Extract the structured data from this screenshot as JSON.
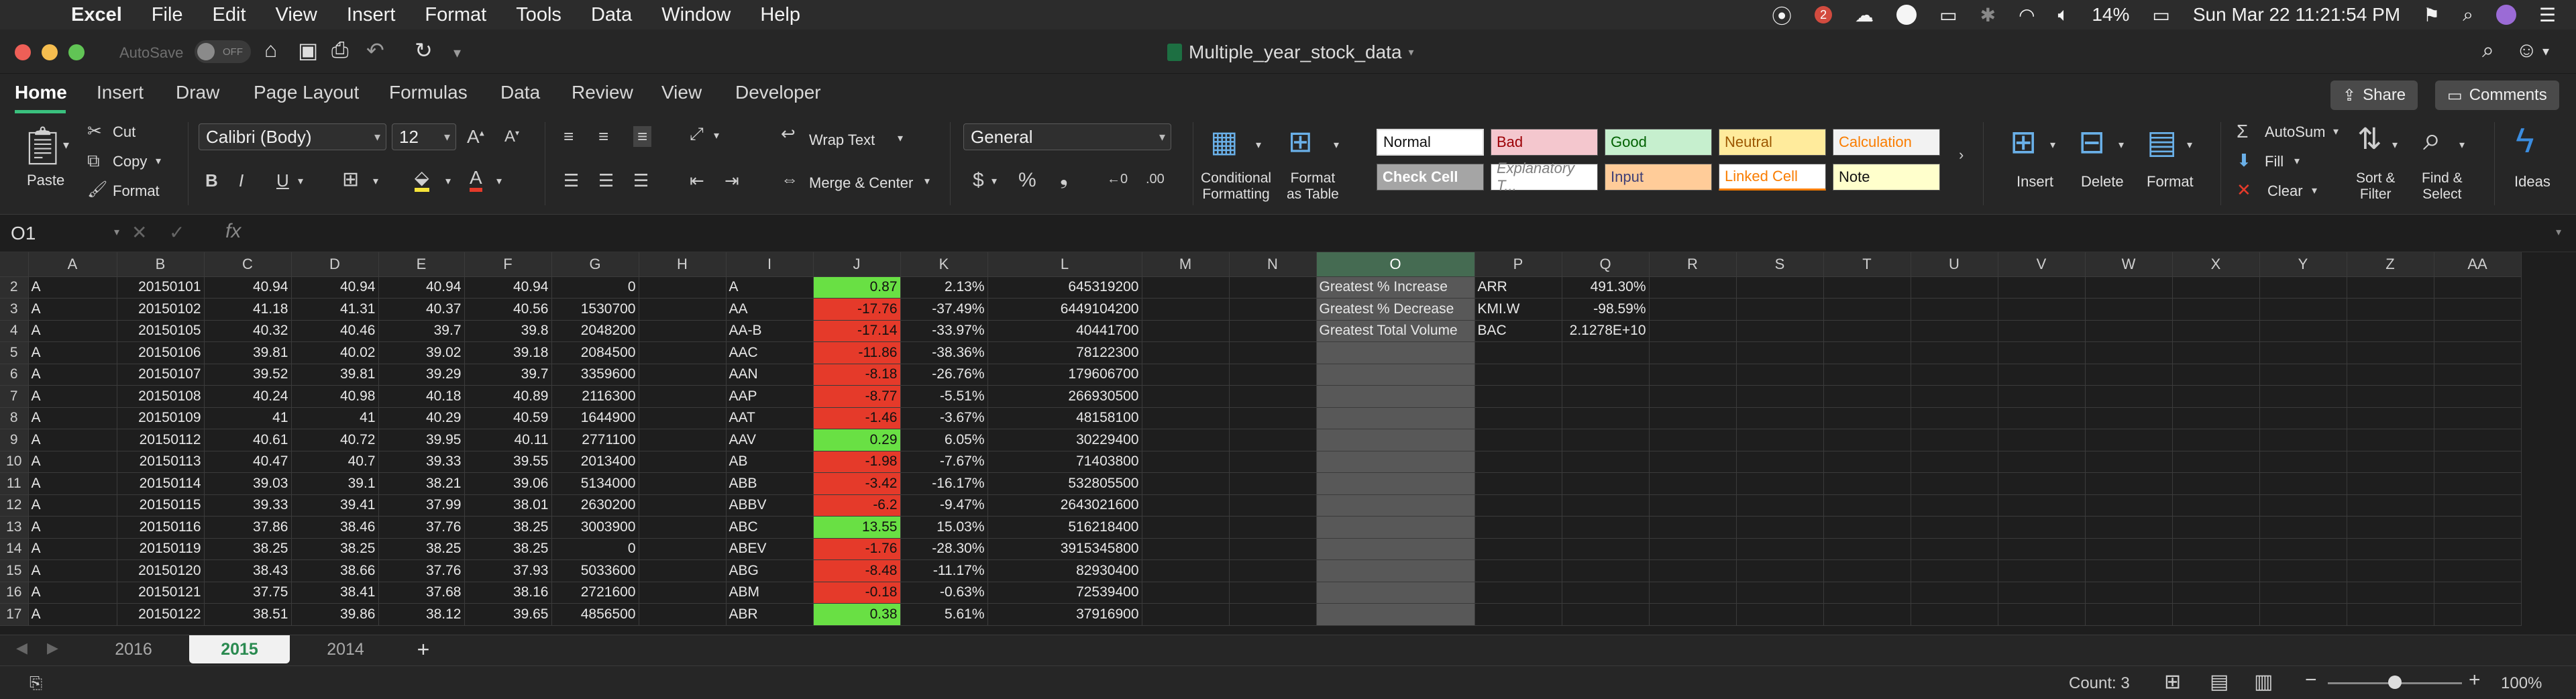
{
  "menubar": {
    "app": "Excel",
    "items": [
      "File",
      "Edit",
      "View",
      "Insert",
      "Format",
      "Tools",
      "Data",
      "Window",
      "Help"
    ],
    "badge": "2",
    "battery": "14%",
    "datetime": "Sun Mar 22  11:21:54 PM"
  },
  "titlebar": {
    "autosave": "AutoSave",
    "toggle": "OFF",
    "document": "Multiple_year_stock_data"
  },
  "ribbon_tabs": [
    "Home",
    "Insert",
    "Draw",
    "Page Layout",
    "Formulas",
    "Data",
    "Review",
    "View",
    "Developer"
  ],
  "share": "Share",
  "comments": "Comments",
  "ribbon": {
    "paste": "Paste",
    "cut": "Cut",
    "copy": "Copy",
    "format": "Format",
    "font": "Calibri (Body)",
    "size": "12",
    "wrap": "Wrap Text",
    "merge": "Merge & Center",
    "number_format": "General",
    "cond": "Conditional\nFormatting",
    "fmt_table": "Format\nas Table",
    "styles": [
      {
        "label": "Normal",
        "bg": "#ffffff",
        "fg": "#111111"
      },
      {
        "label": "Bad",
        "bg": "#f4c7ce",
        "fg": "#9c0006"
      },
      {
        "label": "Good",
        "bg": "#c6efce",
        "fg": "#006100"
      },
      {
        "label": "Neutral",
        "bg": "#ffeb9c",
        "fg": "#9c5700"
      },
      {
        "label": "Calculation",
        "bg": "#f2f2f2",
        "fg": "#fa7d00"
      },
      {
        "label": "Check Cell",
        "bg": "#a5a5a5",
        "fg": "#ffffff"
      },
      {
        "label": "Explanatory T...",
        "bg": "#ffffff",
        "fg": "#7f7f7f"
      },
      {
        "label": "Input",
        "bg": "#ffcc99",
        "fg": "#3f3f76"
      },
      {
        "label": "Linked Cell",
        "bg": "#ffffff",
        "fg": "#fa7d00"
      },
      {
        "label": "Note",
        "bg": "#ffffcc",
        "fg": "#111111"
      }
    ],
    "insert": "Insert",
    "delete": "Delete",
    "format_cells": "Format",
    "autosum": "AutoSum",
    "fill": "Fill",
    "clear": "Clear",
    "sort": "Sort &\nFilter",
    "find": "Find &\nSelect",
    "ideas": "Ideas"
  },
  "formula_bar": {
    "name_box": "O1",
    "fx": "fx",
    "value": ""
  },
  "columns": [
    "A",
    "B",
    "C",
    "D",
    "E",
    "F",
    "G",
    "H",
    "I",
    "J",
    "K",
    "L",
    "M",
    "N",
    "O",
    "P",
    "Q",
    "R",
    "S",
    "T",
    "U",
    "V",
    "W",
    "X",
    "Y",
    "Z",
    "AA"
  ],
  "rows": [
    {
      "n": "2",
      "a": "A",
      "b": "20150101",
      "c": "40.94",
      "d": "40.94",
      "e": "40.94",
      "f": "40.94",
      "g": "0",
      "i": "A",
      "j": "0.87",
      "jc": "green",
      "k": "2.13%",
      "l": "645319200",
      "o": "Greatest % Increase",
      "p": "ARR",
      "q": "491.30%"
    },
    {
      "n": "3",
      "a": "A",
      "b": "20150102",
      "c": "41.18",
      "d": "41.31",
      "e": "40.37",
      "f": "40.56",
      "g": "1530700",
      "i": "AA",
      "j": "-17.76",
      "jc": "red",
      "k": "-37.49%",
      "l": "6449104200",
      "o": "Greatest % Decrease",
      "p": "KMI.W",
      "q": "-98.59%"
    },
    {
      "n": "4",
      "a": "A",
      "b": "20150105",
      "c": "40.32",
      "d": "40.46",
      "e": "39.7",
      "f": "39.8",
      "g": "2048200",
      "i": "AA-B",
      "j": "-17.14",
      "jc": "red",
      "k": "-33.97%",
      "l": "40441700",
      "o": "Greatest Total Volume",
      "p": "BAC",
      "q": "2.1278E+10"
    },
    {
      "n": "5",
      "a": "A",
      "b": "20150106",
      "c": "39.81",
      "d": "40.02",
      "e": "39.02",
      "f": "39.18",
      "g": "2084500",
      "i": "AAC",
      "j": "-11.86",
      "jc": "red",
      "k": "-38.36%",
      "l": "78122300",
      "o": "",
      "p": "",
      "q": ""
    },
    {
      "n": "6",
      "a": "A",
      "b": "20150107",
      "c": "39.52",
      "d": "39.81",
      "e": "39.29",
      "f": "39.7",
      "g": "3359600",
      "i": "AAN",
      "j": "-8.18",
      "jc": "red",
      "k": "-26.76%",
      "l": "179606700",
      "o": "",
      "p": "",
      "q": ""
    },
    {
      "n": "7",
      "a": "A",
      "b": "20150108",
      "c": "40.24",
      "d": "40.98",
      "e": "40.18",
      "f": "40.89",
      "g": "2116300",
      "i": "AAP",
      "j": "-8.77",
      "jc": "red",
      "k": "-5.51%",
      "l": "266930500",
      "o": "",
      "p": "",
      "q": ""
    },
    {
      "n": "8",
      "a": "A",
      "b": "20150109",
      "c": "41",
      "d": "41",
      "e": "40.29",
      "f": "40.59",
      "g": "1644900",
      "i": "AAT",
      "j": "-1.46",
      "jc": "red",
      "k": "-3.67%",
      "l": "48158100",
      "o": "",
      "p": "",
      "q": ""
    },
    {
      "n": "9",
      "a": "A",
      "b": "20150112",
      "c": "40.61",
      "d": "40.72",
      "e": "39.95",
      "f": "40.11",
      "g": "2771100",
      "i": "AAV",
      "j": "0.29",
      "jc": "green",
      "k": "6.05%",
      "l": "30229400",
      "o": "",
      "p": "",
      "q": ""
    },
    {
      "n": "10",
      "a": "A",
      "b": "20150113",
      "c": "40.47",
      "d": "40.7",
      "e": "39.33",
      "f": "39.55",
      "g": "2013400",
      "i": "AB",
      "j": "-1.98",
      "jc": "red",
      "k": "-7.67%",
      "l": "71403800",
      "o": "",
      "p": "",
      "q": ""
    },
    {
      "n": "11",
      "a": "A",
      "b": "20150114",
      "c": "39.03",
      "d": "39.1",
      "e": "38.21",
      "f": "39.06",
      "g": "5134000",
      "i": "ABB",
      "j": "-3.42",
      "jc": "red",
      "k": "-16.17%",
      "l": "532805500",
      "o": "",
      "p": "",
      "q": ""
    },
    {
      "n": "12",
      "a": "A",
      "b": "20150115",
      "c": "39.33",
      "d": "39.41",
      "e": "37.99",
      "f": "38.01",
      "g": "2630200",
      "i": "ABBV",
      "j": "-6.2",
      "jc": "red",
      "k": "-9.47%",
      "l": "2643021600",
      "o": "",
      "p": "",
      "q": ""
    },
    {
      "n": "13",
      "a": "A",
      "b": "20150116",
      "c": "37.86",
      "d": "38.46",
      "e": "37.76",
      "f": "38.25",
      "g": "3003900",
      "i": "ABC",
      "j": "13.55",
      "jc": "green",
      "k": "15.03%",
      "l": "516218400",
      "o": "",
      "p": "",
      "q": ""
    },
    {
      "n": "14",
      "a": "A",
      "b": "20150119",
      "c": "38.25",
      "d": "38.25",
      "e": "38.25",
      "f": "38.25",
      "g": "0",
      "i": "ABEV",
      "j": "-1.76",
      "jc": "red",
      "k": "-28.30%",
      "l": "3915345800",
      "o": "",
      "p": "",
      "q": ""
    },
    {
      "n": "15",
      "a": "A",
      "b": "20150120",
      "c": "38.43",
      "d": "38.66",
      "e": "37.76",
      "f": "37.93",
      "g": "5033600",
      "i": "ABG",
      "j": "-8.48",
      "jc": "red",
      "k": "-11.17%",
      "l": "82930400",
      "o": "",
      "p": "",
      "q": ""
    },
    {
      "n": "16",
      "a": "A",
      "b": "20150121",
      "c": "37.75",
      "d": "38.41",
      "e": "37.68",
      "f": "38.16",
      "g": "2721600",
      "i": "ABM",
      "j": "-0.18",
      "jc": "red",
      "k": "-0.63%",
      "l": "72539400",
      "o": "",
      "p": "",
      "q": ""
    },
    {
      "n": "17",
      "a": "A",
      "b": "20150122",
      "c": "38.51",
      "d": "39.86",
      "e": "38.12",
      "f": "39.65",
      "g": "4856500",
      "i": "ABR",
      "j": "0.38",
      "jc": "green",
      "k": "5.61%",
      "l": "37916900",
      "o": "",
      "p": "",
      "q": ""
    }
  ],
  "sheets": [
    "2016",
    "2015",
    "2014"
  ],
  "add_sheet": "+",
  "status": {
    "count": "Count: 3",
    "zoom": "100%"
  }
}
